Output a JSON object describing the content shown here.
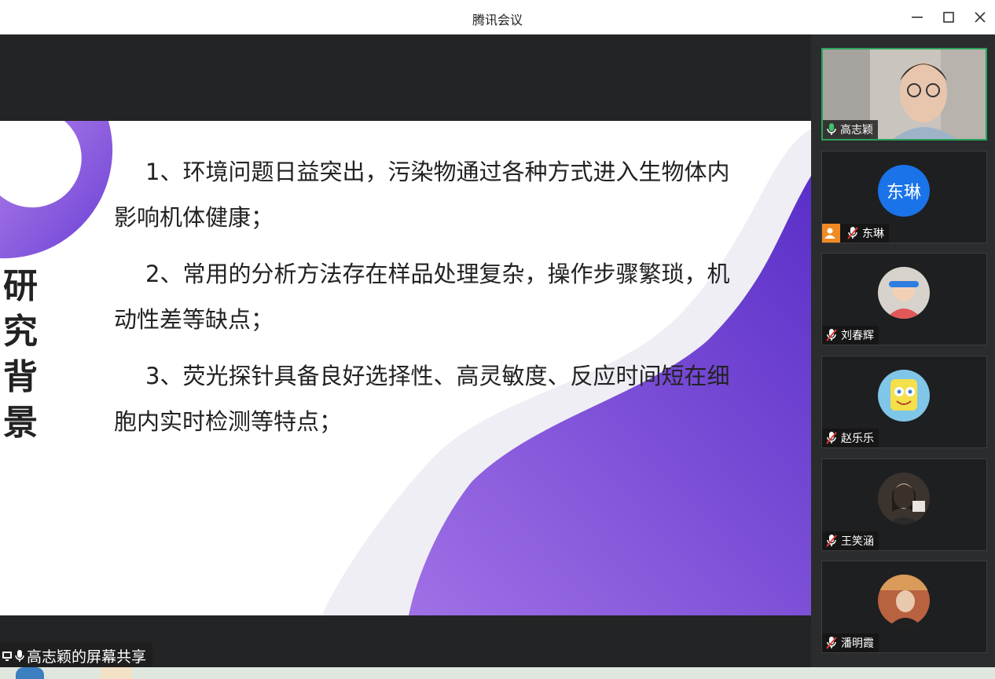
{
  "window": {
    "title": "腾讯会议"
  },
  "slide": {
    "heading_chars": [
      "研",
      "究",
      "背",
      "景"
    ],
    "paragraphs": [
      "1、环境问题日益突出，污染物通过各种方式进入生物体内影响机体健康；",
      "2、常用的分析方法存在样品处理复杂，操作步骤繁琐，机动性差等缺点；",
      "3、荧光探针具备良好选择性、高灵敏度、反应时间短在细胞内实时检测等特点；"
    ]
  },
  "share_label": "高志颖的屏幕共享",
  "participants": [
    {
      "name": "高志颖",
      "mic": "on",
      "kind": "video"
    },
    {
      "name": "东琳",
      "mic": "muted",
      "kind": "initials",
      "avatar_text": "东琳",
      "host": true
    },
    {
      "name": "刘春辉",
      "mic": "muted",
      "kind": "photo"
    },
    {
      "name": "赵乐乐",
      "mic": "muted",
      "kind": "photo"
    },
    {
      "name": "王笑涵",
      "mic": "muted",
      "kind": "photo"
    },
    {
      "name": "潘明霞",
      "mic": "muted",
      "kind": "photo"
    }
  ],
  "colors": {
    "accent_purple": "#6a3fd6",
    "active_border": "#2ba35a",
    "avatar_blue": "#1a73e8",
    "host_orange": "#f08a24"
  },
  "icons": [
    "minimize-icon",
    "maximize-icon",
    "close-icon",
    "mic-on-icon",
    "mic-muted-icon",
    "host-icon",
    "screen-share-icon"
  ]
}
